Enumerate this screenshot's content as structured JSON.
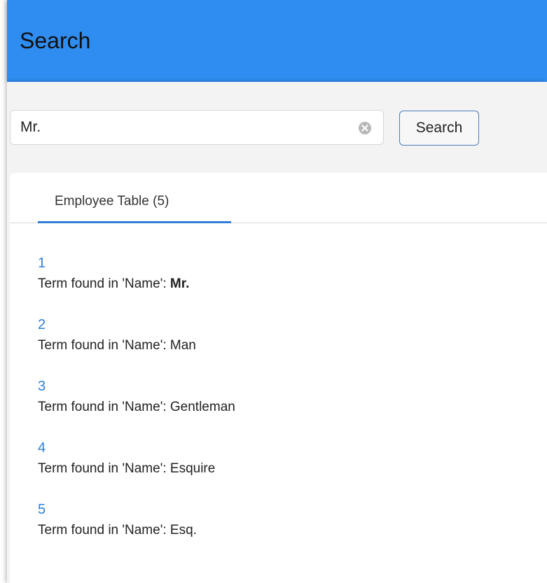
{
  "header": {
    "title": "Search"
  },
  "search": {
    "value": "Mr.",
    "button_label": "Search"
  },
  "tabs": [
    {
      "label": "Employee Table (5)"
    }
  ],
  "results": [
    {
      "id": "1",
      "prefix": "Term found in 'Name': ",
      "term": "Mr.",
      "emphasized": true
    },
    {
      "id": "2",
      "prefix": "Term found in 'Name': ",
      "term": "Man",
      "emphasized": false
    },
    {
      "id": "3",
      "prefix": "Term found in 'Name': ",
      "term": "Gentleman",
      "emphasized": false
    },
    {
      "id": "4",
      "prefix": "Term found in 'Name': ",
      "term": "Esquire",
      "emphasized": false
    },
    {
      "id": "5",
      "prefix": "Term found in 'Name': ",
      "term": "Esq.",
      "emphasized": false
    }
  ],
  "colors": {
    "header": "#2f8cf0",
    "accent": "#2f7fd8",
    "body_background": "#f3f3f3"
  },
  "icons": {
    "clear": "clear-icon"
  }
}
